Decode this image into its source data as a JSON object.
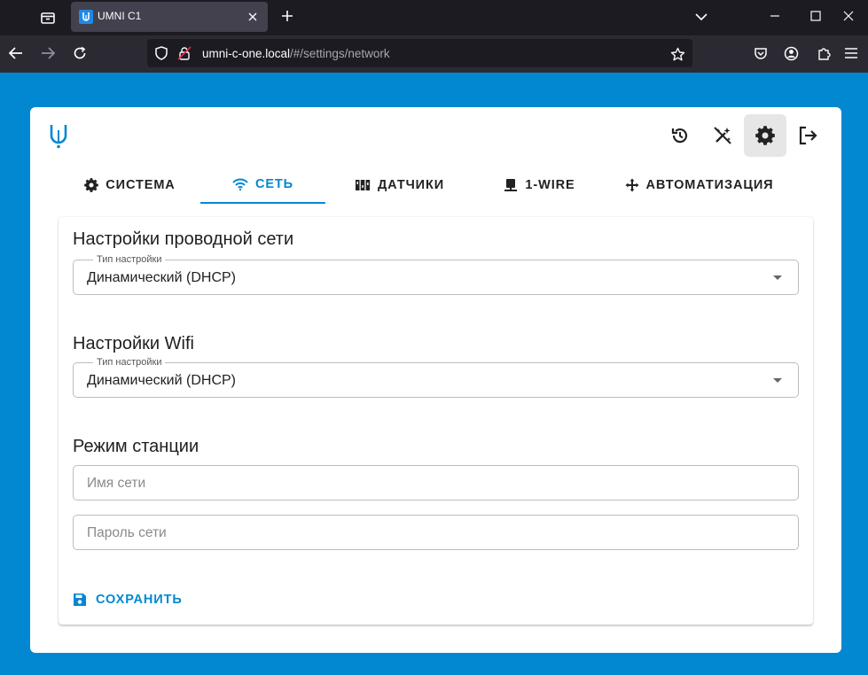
{
  "browser": {
    "tab_title": "UMNI C1",
    "url_host": "umni-c-one.local",
    "url_path": "/#/settings/network"
  },
  "app": {
    "nav_tabs": [
      {
        "label": "СИСТЕМА",
        "icon": "gear-icon"
      },
      {
        "label": "СЕТЬ",
        "icon": "wifi-icon",
        "active": true
      },
      {
        "label": "ДАТЧИКИ",
        "icon": "sensors-icon"
      },
      {
        "label": "1-WIRE",
        "icon": "device-icon"
      },
      {
        "label": "АВТОМАТИЗАЦИЯ",
        "icon": "move-icon"
      }
    ],
    "wired": {
      "title": "Настройки проводной сети",
      "legend": "Тип настройки",
      "value": "Динамический (DHCP)"
    },
    "wifi": {
      "title": "Настройки Wifi",
      "legend": "Тип настройки",
      "value": "Динамический (DHCP)"
    },
    "station": {
      "title": "Режим станции",
      "ssid_placeholder": "Имя сети",
      "password_placeholder": "Пароль сети"
    },
    "save_label": "СОХРАНИТЬ"
  },
  "colors": {
    "accent": "#0288d1",
    "page_bg": "#0288d1",
    "tabbar_bg": "#1c1b22",
    "navbar_bg": "#2b2a33"
  }
}
